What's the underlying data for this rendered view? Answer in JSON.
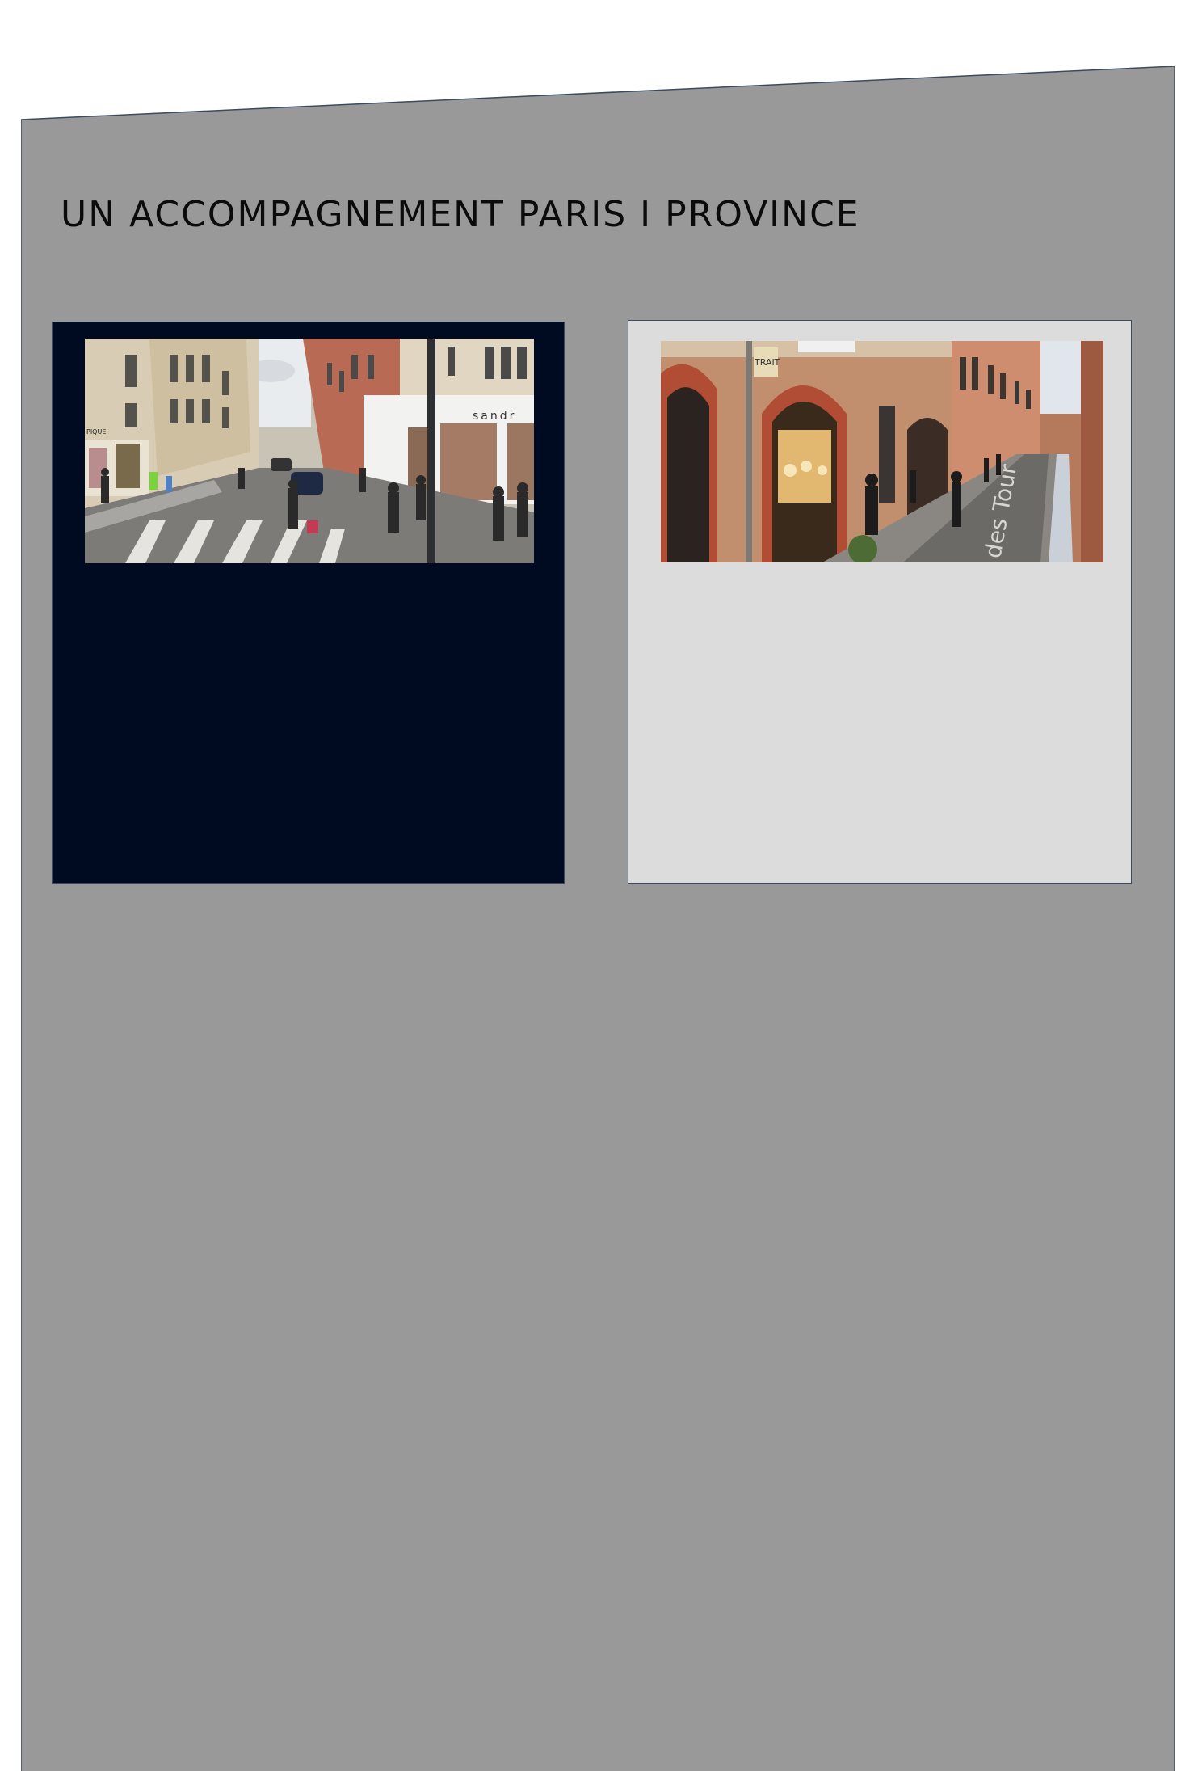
{
  "heading": "UN ACCOMPAGNEMENT PARIS I PROVINCE",
  "cards": [
    {
      "photo": "Paris street scene with Haussmann buildings, pedestrians and crosswalk",
      "shop_sign": "sandr",
      "left_sign": "PIQUE"
    },
    {
      "photo": "Toulouse brick street with arched shop fronts",
      "shop_sign": "TRAIT",
      "street_text": "des Tour"
    }
  ],
  "colors": {
    "panel": "#999999",
    "card_dark": "#000b21",
    "card_light": "#dcdcdc",
    "border": "#3b4a63"
  }
}
